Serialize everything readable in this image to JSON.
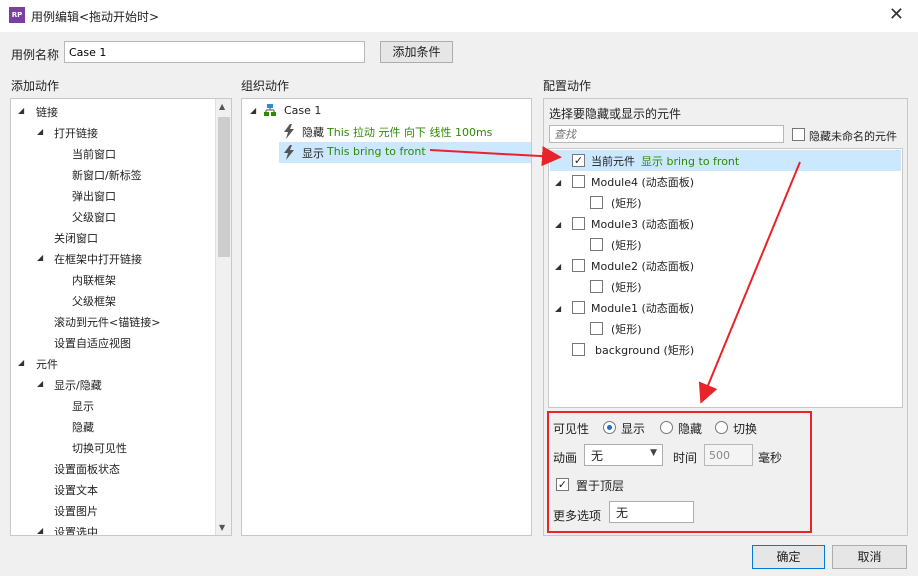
{
  "app_logo": "RP",
  "window": {
    "title": "用例编辑<拖动开始时>",
    "close_glyph": "✕"
  },
  "case_name": {
    "label": "用例名称",
    "value": "Case 1",
    "add_condition": "添加条件"
  },
  "left_panel": {
    "title": "添加动作",
    "items": [
      {
        "label": "链接"
      },
      {
        "label": "打开链接"
      },
      {
        "label": "当前窗口"
      },
      {
        "label": "新窗口/新标签"
      },
      {
        "label": "弹出窗口"
      },
      {
        "label": "父级窗口"
      },
      {
        "label": "关闭窗口"
      },
      {
        "label": "在框架中打开链接"
      },
      {
        "label": "内联框架"
      },
      {
        "label": "父级框架"
      },
      {
        "label": "滚动到元件<锚链接>"
      },
      {
        "label": "设置自适应视图"
      },
      {
        "label": "元件"
      },
      {
        "label": "显示/隐藏"
      },
      {
        "label": "显示"
      },
      {
        "label": "隐藏"
      },
      {
        "label": "切换可见性"
      },
      {
        "label": "设置面板状态"
      },
      {
        "label": "设置文本"
      },
      {
        "label": "设置图片"
      },
      {
        "label": "设置选中"
      }
    ]
  },
  "middle_panel": {
    "title": "组织动作",
    "case_label": "Case 1",
    "actions": [
      {
        "verb": "隐藏",
        "detail": "This 拉动 元件 向下 线性 100ms"
      },
      {
        "verb": "显示",
        "detail": "This bring to front"
      }
    ]
  },
  "right_panel": {
    "title": "配置动作",
    "subtitle": "选择要隐藏或显示的元件",
    "search_placeholder": "查找",
    "hide_unnamed": "隐藏未命名的元件",
    "widgets": [
      {
        "name": "当前元件",
        "detail": "显示 bring to front",
        "checked": true
      },
      {
        "name": "Module4 (动态面板)"
      },
      {
        "name": "(矩形)"
      },
      {
        "name": "Module3 (动态面板)"
      },
      {
        "name": "(矩形)"
      },
      {
        "name": "Module2 (动态面板)"
      },
      {
        "name": "(矩形)"
      },
      {
        "name": "Module1 (动态面板)"
      },
      {
        "name": "(矩形)"
      },
      {
        "name": "background (矩形)"
      }
    ],
    "visibility": {
      "label": "可见性",
      "options": [
        "显示",
        "隐藏",
        "切换"
      ],
      "selected": "显示"
    },
    "animation": {
      "label": "动画",
      "value": "无",
      "time_label": "时间",
      "time_value": "500",
      "unit": "毫秒"
    },
    "bring_to_front": {
      "label": "置于顶层",
      "checked": true
    },
    "more_options": {
      "label": "更多选项",
      "value": "无"
    }
  },
  "footer": {
    "ok": "确定",
    "cancel": "取消"
  },
  "colors": {
    "annotation_red": "#e8232a",
    "action_green": "#2e8b00",
    "selected_row": "#cce8ff"
  }
}
